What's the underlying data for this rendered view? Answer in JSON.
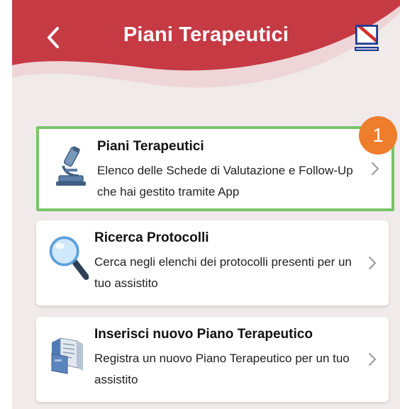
{
  "header": {
    "title": "Piani Terapeutici",
    "back_icon": "chevron-left-icon",
    "logo": "regione-campania-logo",
    "brand_color": "#c63a44"
  },
  "cards": [
    {
      "title": "Piani Terapeutici",
      "description": "Elenco delle Schede di Valutazione e Follow-Up che hai gestito tramite App",
      "icon": "microscope-icon",
      "highlighted": true
    },
    {
      "title": "Ricerca Protocolli",
      "description": "Cerca negli elenchi dei protocolli presenti per un tuo assistito",
      "icon": "magnifier-icon",
      "highlighted": false
    },
    {
      "title": "Inserisci nuovo Piano Terapeutico",
      "description": "Registra un nuovo Piano Terapeutico per un tuo assistito",
      "icon": "document-folder-icon",
      "highlighted": false
    }
  ],
  "annotation": {
    "badge_number": "1",
    "badge_color": "#ee7d2c",
    "highlight_color": "#7ac36a"
  }
}
